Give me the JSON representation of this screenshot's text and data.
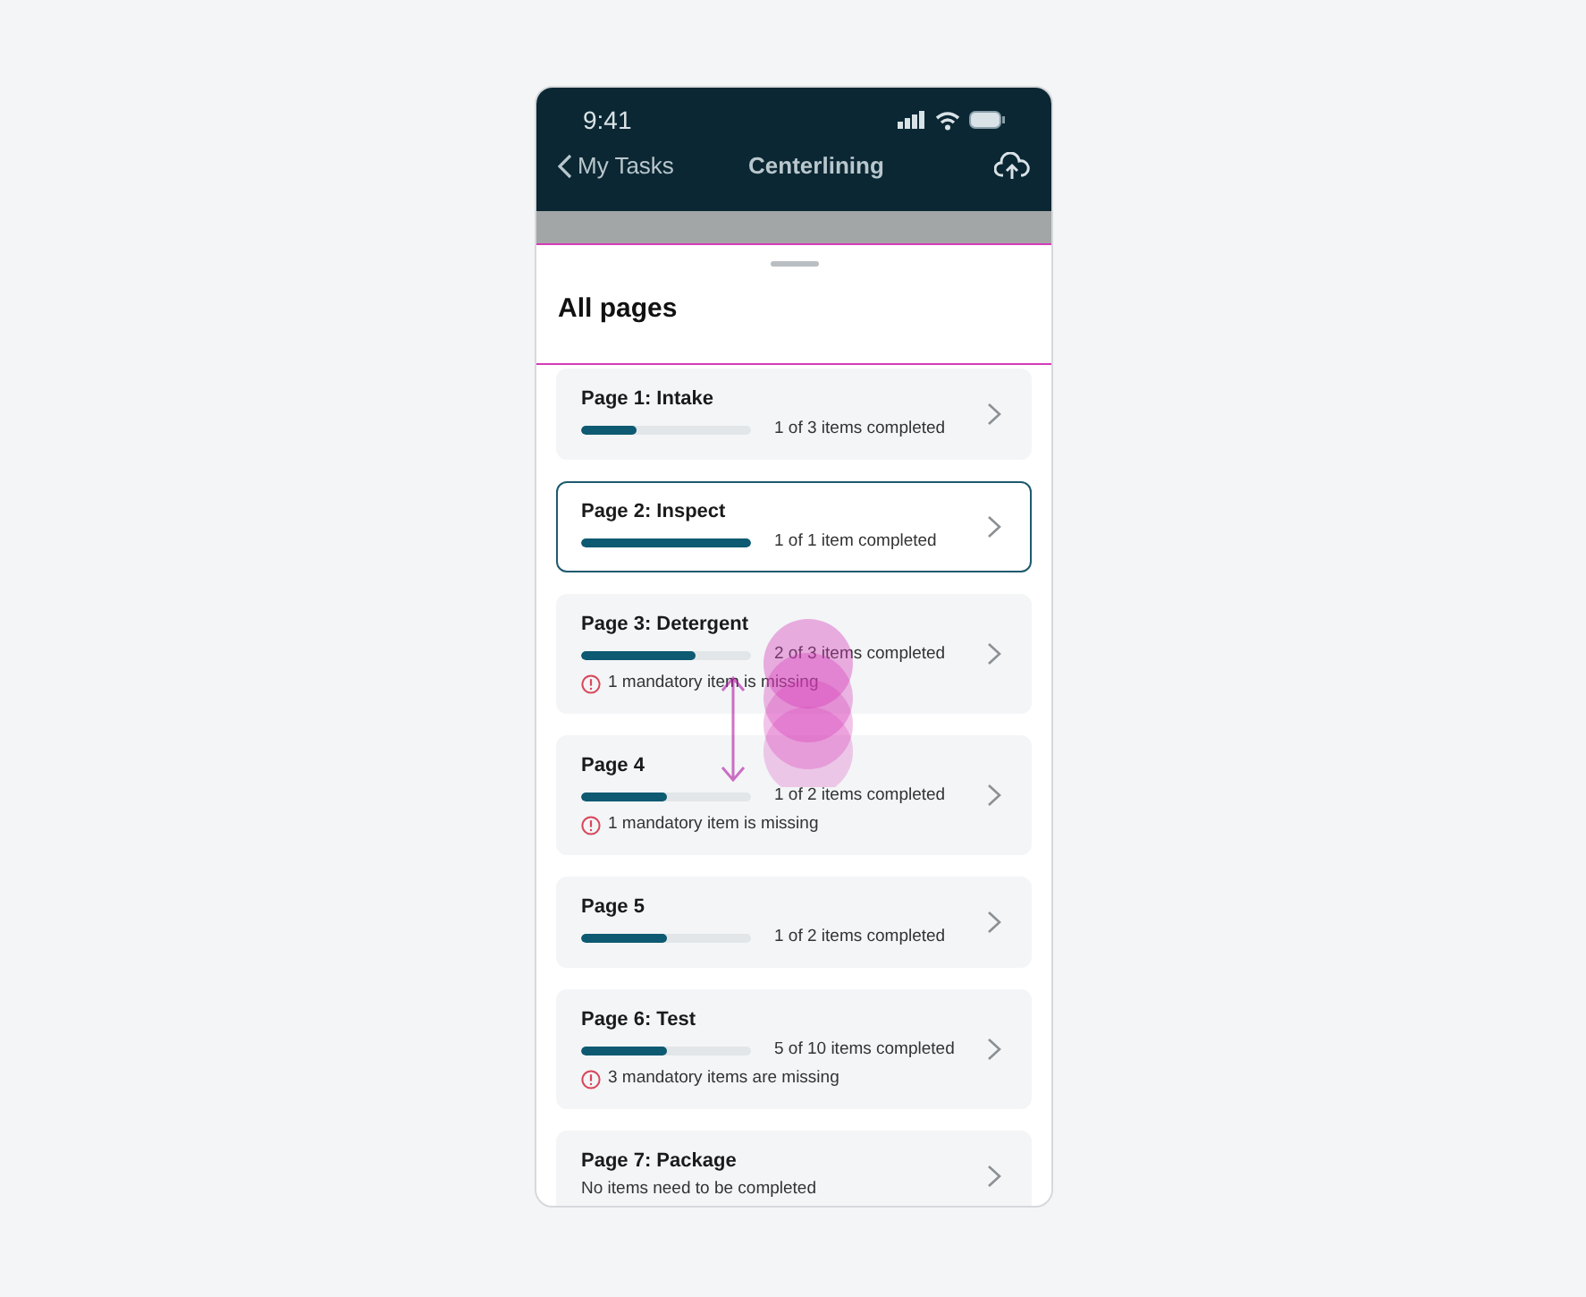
{
  "status_bar": {
    "time": "9:41"
  },
  "nav": {
    "back_label": "My Tasks",
    "title": "Centerlining"
  },
  "sheet": {
    "title": "All pages"
  },
  "pages": [
    {
      "title": "Page 1: Intake",
      "kind": "progress",
      "level": 0.33,
      "progress_text": "1 of 3 items completed",
      "selected": false
    },
    {
      "title": "Page 2: Inspect",
      "kind": "progress",
      "level": 1,
      "progress_text": "1 of 1 item completed",
      "selected": true
    },
    {
      "title": "Page 3: Detergent",
      "kind": "progress",
      "level": 0.67,
      "progress_text": "2 of 3 items completed",
      "warning": "1 mandatory item is missing",
      "selected": false
    },
    {
      "title": "Page 4",
      "kind": "progress",
      "level": 0.5,
      "progress_text": "1 of 2 items completed",
      "warning": "1 mandatory item is missing",
      "selected": false
    },
    {
      "title": "Page 5",
      "kind": "progress",
      "level": 0.5,
      "progress_text": "1 of 2 items completed",
      "selected": false
    },
    {
      "title": "Page 6: Test",
      "kind": "progress",
      "level": 0.5,
      "progress_text": "5 of 10 items completed",
      "warning": "3 mandatory items are missing",
      "selected": false
    },
    {
      "title": "Page 7: Package",
      "kind": "note",
      "note": "No items need to be completed",
      "selected": false
    }
  ]
}
